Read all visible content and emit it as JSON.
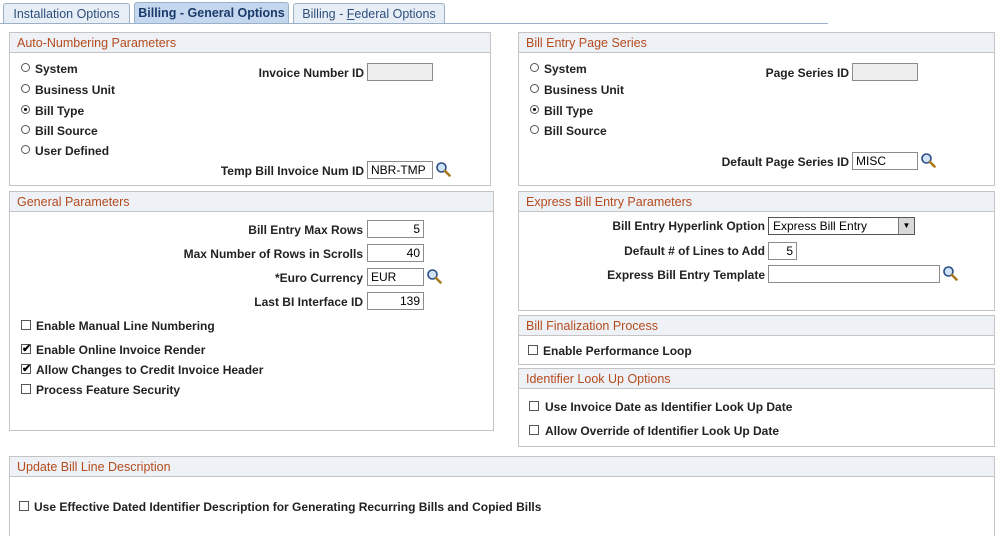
{
  "tabs": [
    {
      "label": "Installation Options"
    },
    {
      "label": "Billing - General Options"
    },
    {
      "label_pre": "Billing - ",
      "label_ul": "F",
      "label_post": "ederal Options"
    }
  ],
  "auto_numbering": {
    "title": "Auto-Numbering Parameters",
    "options": [
      "System",
      "Business Unit",
      "Bill Type",
      "Bill Source",
      "User Defined"
    ],
    "selected": "Bill Type",
    "invoice_number_id_label": "Invoice Number ID",
    "invoice_number_id_value": "",
    "temp_bill_label": "Temp Bill Invoice Num ID",
    "temp_bill_value": "NBR-TMP"
  },
  "bill_entry_page_series": {
    "title": "Bill Entry Page Series",
    "options": [
      "System",
      "Business Unit",
      "Bill Type",
      "Bill Source"
    ],
    "selected": "Bill Type",
    "page_series_id_label": "Page Series ID",
    "page_series_id_value": "",
    "default_page_series_label": "Default Page Series ID",
    "default_page_series_value": "MISC"
  },
  "general_parameters": {
    "title": "General Parameters",
    "max_rows_label": "Bill Entry Max Rows",
    "max_rows_value": "5",
    "max_scroll_label": "Max Number of Rows in Scrolls",
    "max_scroll_value": "40",
    "euro_label": "*Euro Currency",
    "euro_value": "EUR",
    "last_bi_label": "Last BI Interface ID",
    "last_bi_value": "139",
    "checkboxes": [
      {
        "label": "Enable Manual Line Numbering",
        "checked": false
      },
      {
        "label": "Enable Online Invoice Render",
        "checked": true
      },
      {
        "label": "Allow Changes to Credit Invoice Header",
        "checked": true
      },
      {
        "label": "Process Feature Security",
        "checked": false
      }
    ]
  },
  "express_bill": {
    "title": "Express Bill Entry Parameters",
    "hyperlink_label": "Bill Entry Hyperlink Option",
    "hyperlink_value": "Express Bill Entry",
    "lines_label": "Default # of Lines to Add",
    "lines_value": "5",
    "template_label": "Express Bill Entry Template",
    "template_value": ""
  },
  "finalization": {
    "title": "Bill Finalization Process",
    "checkbox_label": "Enable Performance Loop",
    "checked": false
  },
  "identifier_lookup": {
    "title": "Identifier Look Up Options",
    "checkboxes": [
      {
        "label": "Use Invoice Date as Identifier Look Up Date",
        "checked": false
      },
      {
        "label": "Allow Override of Identifier Look Up Date",
        "checked": false
      }
    ]
  },
  "update_bill_line": {
    "title": "Update Bill Line Description",
    "checkbox_label": "Use Effective Dated Identifier Description for Generating Recurring Bills and Copied Bills",
    "checked": false
  },
  "icons": {
    "lookup": "magnifier-lookup-icon",
    "dropdown": "dropdown-arrow-icon"
  }
}
